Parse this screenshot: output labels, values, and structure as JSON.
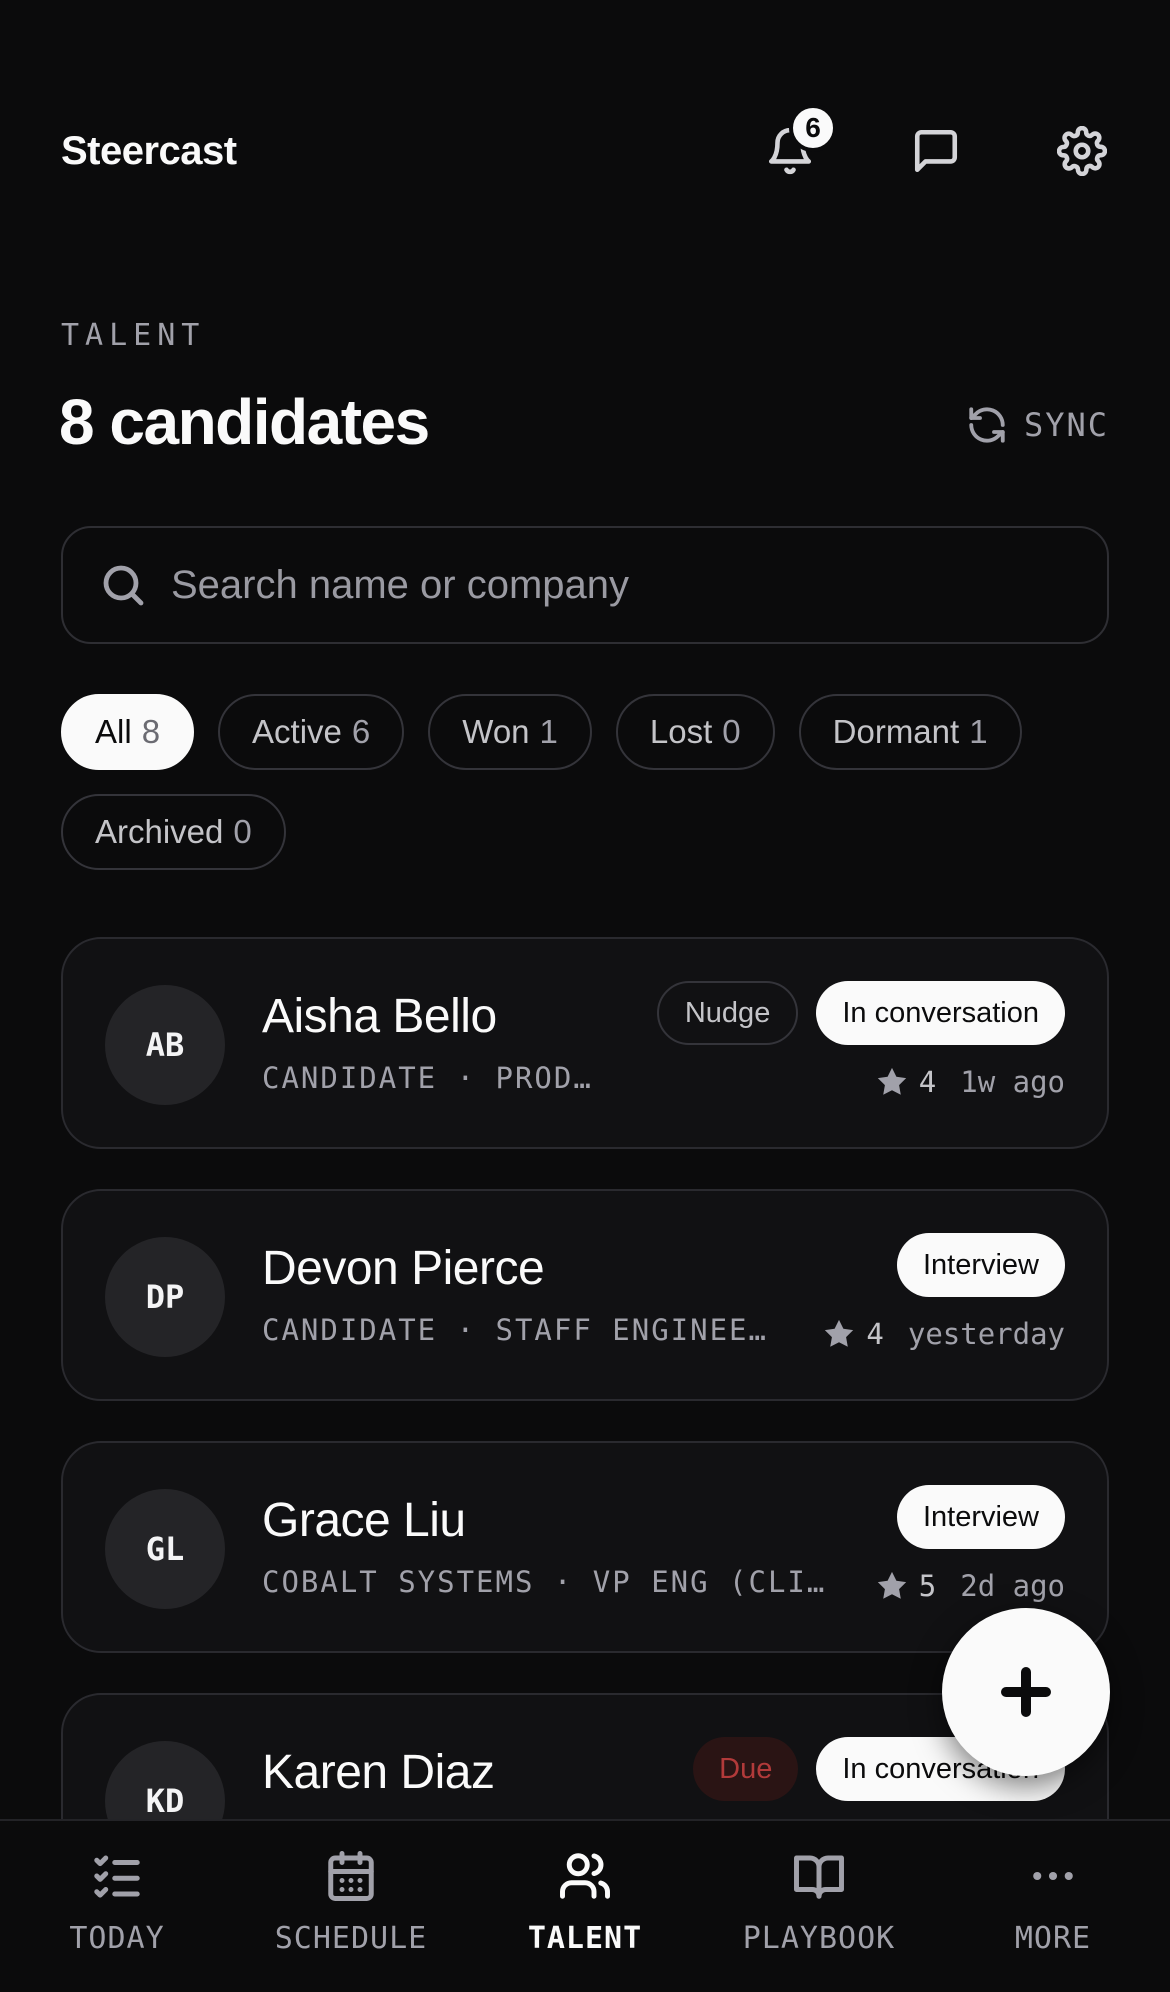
{
  "app": {
    "brand": "Steercast"
  },
  "header": {
    "notifications_count": "6",
    "icons": [
      "bell-icon",
      "message-icon",
      "gear-icon"
    ]
  },
  "section": {
    "eyebrow": "TALENT",
    "title": "8 candidates",
    "sync_label": "SYNC"
  },
  "search": {
    "placeholder": "Search name or company",
    "value": ""
  },
  "filters": [
    {
      "label": "All",
      "count": "8",
      "selected": true
    },
    {
      "label": "Active",
      "count": "6",
      "selected": false
    },
    {
      "label": "Won",
      "count": "1",
      "selected": false
    },
    {
      "label": "Lost",
      "count": "0",
      "selected": false
    },
    {
      "label": "Dormant",
      "count": "1",
      "selected": false
    },
    {
      "label": "Archived",
      "count": "0",
      "selected": false
    }
  ],
  "candidates": [
    {
      "initials": "AB",
      "name": "Aisha Bello",
      "subtitle": "CANDIDATE · PROD…",
      "nudge": "Nudge",
      "status": "In conversation",
      "rating": "4",
      "time": "1w ago"
    },
    {
      "initials": "DP",
      "name": "Devon Pierce",
      "subtitle": "CANDIDATE · STAFF ENGINEE…",
      "status": "Interview",
      "rating": "4",
      "time": "yesterday"
    },
    {
      "initials": "GL",
      "name": "Grace Liu",
      "subtitle": "COBALT SYSTEMS · VP ENG (CLI…",
      "status": "Interview",
      "rating": "5",
      "time": "2d ago"
    },
    {
      "initials": "KD",
      "name": "Karen Diaz",
      "due": "Due",
      "status": "In conversation"
    }
  ],
  "nav": [
    {
      "label": "TODAY",
      "icon": "checklist-icon",
      "active": false
    },
    {
      "label": "SCHEDULE",
      "icon": "calendar-icon",
      "active": false
    },
    {
      "label": "TALENT",
      "icon": "users-icon",
      "active": true
    },
    {
      "label": "PLAYBOOK",
      "icon": "book-icon",
      "active": false
    },
    {
      "label": "MORE",
      "icon": "more-icon",
      "active": false
    }
  ],
  "colors": {
    "background": "#0b0b0c",
    "card": "#111113",
    "accent": "#fafafa",
    "muted": "#a1a1aa",
    "due": "#b23a3a"
  }
}
